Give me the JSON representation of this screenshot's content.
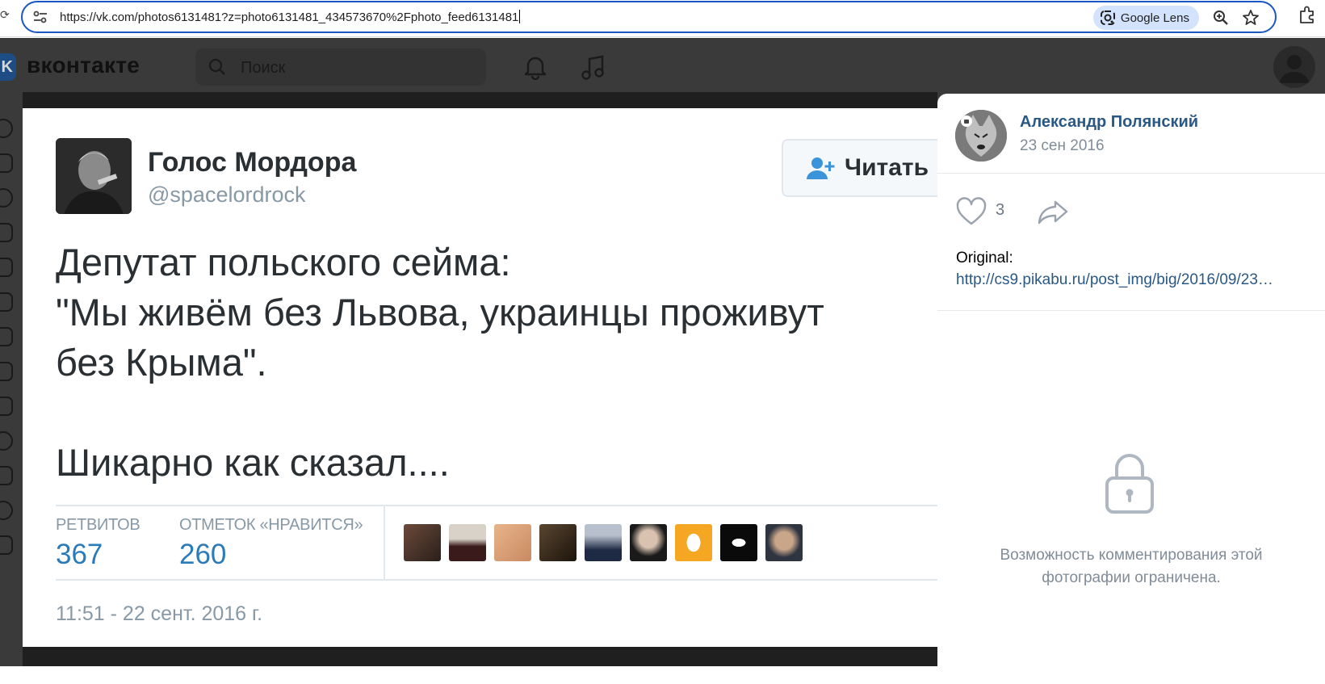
{
  "browser": {
    "url": "https://vk.com/photos6131481?z=photo6131481_434573670%2Fphoto_feed6131481",
    "lens_label": "Google Lens",
    "icons": [
      "tune-icon",
      "google-lens-icon",
      "zoom-icon",
      "star-icon",
      "extensions-icon"
    ]
  },
  "vk_header": {
    "logo_text": "вконтакте",
    "search_placeholder": "Поиск",
    "icons": [
      "bell-icon",
      "music-icon",
      "avatar"
    ]
  },
  "tweet": {
    "name": "Голос Мордора",
    "handle": "@spacelordrock",
    "follow_label": "Читать",
    "lines": [
      "Депутат польского сейма:",
      "\"Мы живём без Львова, украинцы проживут",
      "без Крыма\".",
      "",
      "Шикарно как сказал...."
    ],
    "retweets_label": "РЕТВИТОВ",
    "retweets_value": "367",
    "likes_label": "ОТМЕТОК «НРАВИТСЯ»",
    "likes_value": "260",
    "timestamp": "11:51 - 22 сент. 2016 г."
  },
  "panel": {
    "author": "Александр Полянский",
    "date": "23 сен 2016",
    "like_count": "3",
    "original_label": "Original:",
    "original_link": "http://cs9.pikabu.ru/post_img/big/2016/09/23…",
    "comments_restricted": "Возможность комментирования этой фотографии ограничена."
  },
  "colors": {
    "chrome_focus": "#1a56c4",
    "vk_link": "#2a5885",
    "vk_muted": "#818c99",
    "twitter_blue": "#2b7bb9",
    "twitter_gray": "#8899a6"
  }
}
